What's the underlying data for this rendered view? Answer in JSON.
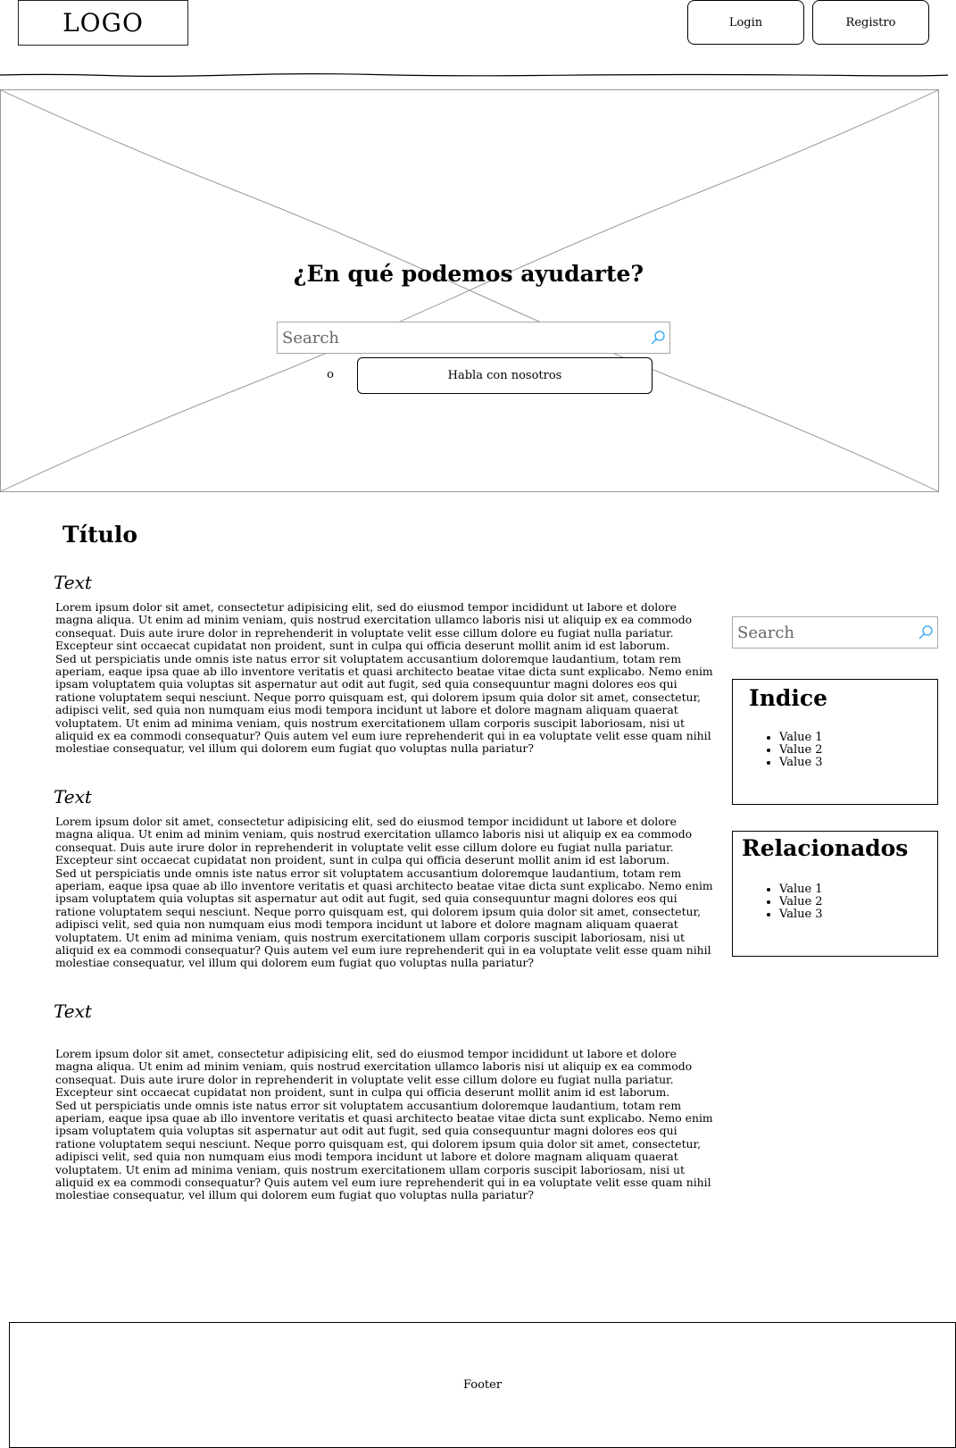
{
  "header": {
    "logo": "LOGO",
    "login_label": "Login",
    "registro_label": "Registro"
  },
  "hero": {
    "title": "¿En qué podemos ayudarte?",
    "search_placeholder": "Search",
    "separator": "o",
    "cta_label": "Habla con nosotros"
  },
  "content": {
    "title": "Título",
    "sections": [
      {
        "heading": "Text",
        "p1": "Lorem ipsum dolor sit amet, consectetur adipisicing elit, sed do eiusmod tempor incididunt ut labore et dolore magna aliqua. Ut enim ad minim veniam, quis nostrud exercitation ullamco laboris nisi ut aliquip ex ea commodo consequat. Duis aute irure dolor in reprehenderit in voluptate velit esse cillum dolore eu fugiat nulla pariatur. Excepteur sint occaecat cupidatat non proident, sunt in culpa qui officia deserunt mollit anim id est laborum.",
        "p2": "Sed ut perspiciatis unde omnis iste natus error sit voluptatem accusantium doloremque laudantium, totam rem aperiam, eaque ipsa quae ab illo inventore veritatis et quasi architecto beatae vitae dicta sunt explicabo. Nemo enim ipsam voluptatem quia voluptas sit aspernatur aut odit aut fugit, sed quia consequuntur magni dolores eos qui ratione voluptatem sequi nesciunt. Neque porro quisquam est, qui dolorem ipsum quia dolor sit amet, consectetur, adipisci velit, sed quia non numquam eius modi tempora incidunt ut labore et dolore magnam aliquam quaerat voluptatem. Ut enim ad minima veniam, quis nostrum exercitationem ullam corporis suscipit laboriosam, nisi ut aliquid ex ea commodi consequatur? Quis autem vel eum iure reprehenderit qui in ea voluptate velit esse quam nihil molestiae consequatur, vel illum qui dolorem eum fugiat quo voluptas nulla pariatur?"
      },
      {
        "heading": "Text",
        "p1": "Lorem ipsum dolor sit amet, consectetur adipisicing elit, sed do eiusmod tempor incididunt ut labore et dolore magna aliqua. Ut enim ad minim veniam, quis nostrud exercitation ullamco laboris nisi ut aliquip ex ea commodo consequat. Duis aute irure dolor in reprehenderit in voluptate velit esse cillum dolore eu fugiat nulla pariatur. Excepteur sint occaecat cupidatat non proident, sunt in culpa qui officia deserunt mollit anim id est laborum.",
        "p2": "Sed ut perspiciatis unde omnis iste natus error sit voluptatem accusantium doloremque laudantium, totam rem aperiam, eaque ipsa quae ab illo inventore veritatis et quasi architecto beatae vitae dicta sunt explicabo. Nemo enim ipsam voluptatem quia voluptas sit aspernatur aut odit aut fugit, sed quia consequuntur magni dolores eos qui ratione voluptatem sequi nesciunt. Neque porro quisquam est, qui dolorem ipsum quia dolor sit amet, consectetur, adipisci velit, sed quia non numquam eius modi tempora incidunt ut labore et dolore magnam aliquam quaerat voluptatem. Ut enim ad minima veniam, quis nostrum exercitationem ullam corporis suscipit laboriosam, nisi ut aliquid ex ea commodi consequatur? Quis autem vel eum iure reprehenderit qui in ea voluptate velit esse quam nihil molestiae consequatur, vel illum qui dolorem eum fugiat quo voluptas nulla pariatur?"
      },
      {
        "heading": "Text",
        "p1": "Lorem ipsum dolor sit amet, consectetur adipisicing elit, sed do eiusmod tempor incididunt ut labore et dolore magna aliqua. Ut enim ad minim veniam, quis nostrud exercitation ullamco laboris nisi ut aliquip ex ea commodo consequat. Duis aute irure dolor in reprehenderit in voluptate velit esse cillum dolore eu fugiat nulla pariatur. Excepteur sint occaecat cupidatat non proident, sunt in culpa qui officia deserunt mollit anim id est laborum.",
        "p2": "Sed ut perspiciatis unde omnis iste natus error sit voluptatem accusantium doloremque laudantium, totam rem aperiam, eaque ipsa quae ab illo inventore veritatis et quasi architecto beatae vitae dicta sunt explicabo. Nemo enim ipsam voluptatem quia voluptas sit aspernatur aut odit aut fugit, sed quia consequuntur magni dolores eos qui ratione voluptatem sequi nesciunt. Neque porro quisquam est, qui dolorem ipsum quia dolor sit amet, consectetur, adipisci velit, sed quia non numquam eius modi tempora incidunt ut labore et dolore magnam aliquam quaerat voluptatem. Ut enim ad minima veniam, quis nostrum exercitationem ullam corporis suscipit laboriosam, nisi ut aliquid ex ea commodi consequatur? Quis autem vel eum iure reprehenderit qui in ea voluptate velit esse quam nihil molestiae consequatur, vel illum qui dolorem eum fugiat quo voluptas nulla pariatur?"
      }
    ]
  },
  "sidebar": {
    "search_placeholder": "Search",
    "indice": {
      "title": "Indice",
      "items": [
        "Value 1",
        "Value 2",
        "Value 3"
      ]
    },
    "relacionados": {
      "title": "Relacionados",
      "items": [
        "Value 1",
        "Value 2",
        "Value 3"
      ]
    }
  },
  "footer": {
    "label": "Footer"
  },
  "colors": {
    "search_icon": "#29a3ef",
    "placeholder_border": "#999999"
  },
  "icons": {
    "search": "search-icon"
  }
}
